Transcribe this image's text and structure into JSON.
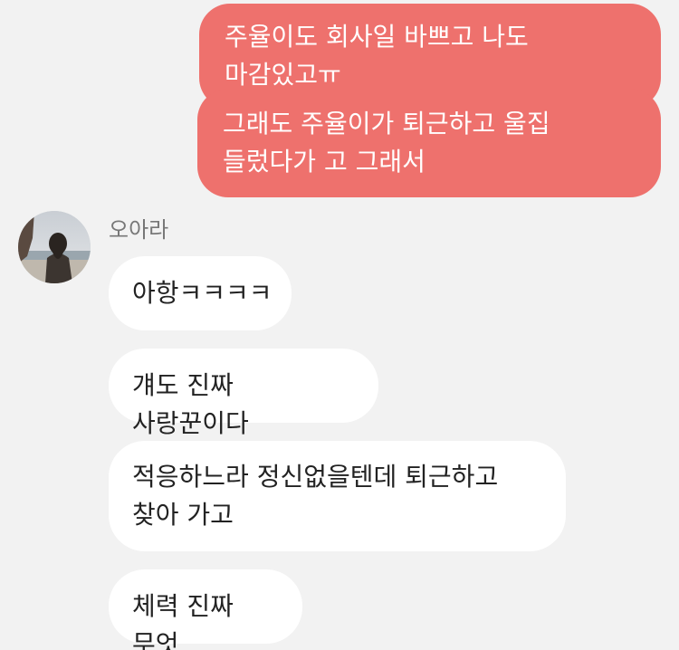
{
  "sent_messages": [
    "주율이도 회사일 바쁘고 나도 마감있고ㅠ",
    "그래도 주율이가 퇴근하고 울집 들렀다가 고 그래서"
  ],
  "contact": {
    "name": "오아라",
    "avatar_icon": "profile-photo-person-at-beach"
  },
  "received_messages": [
    "아항ㅋㅋㅋㅋ",
    "걔도 진짜 사랑꾼이다",
    "적응하느라 정신없을텐데 퇴근하고 찾아 가고",
    "체력 진짜 무엇"
  ],
  "colors": {
    "background": "#f2f2f2",
    "sent_bubble": "#ee716d",
    "received_bubble": "#ffffff"
  }
}
